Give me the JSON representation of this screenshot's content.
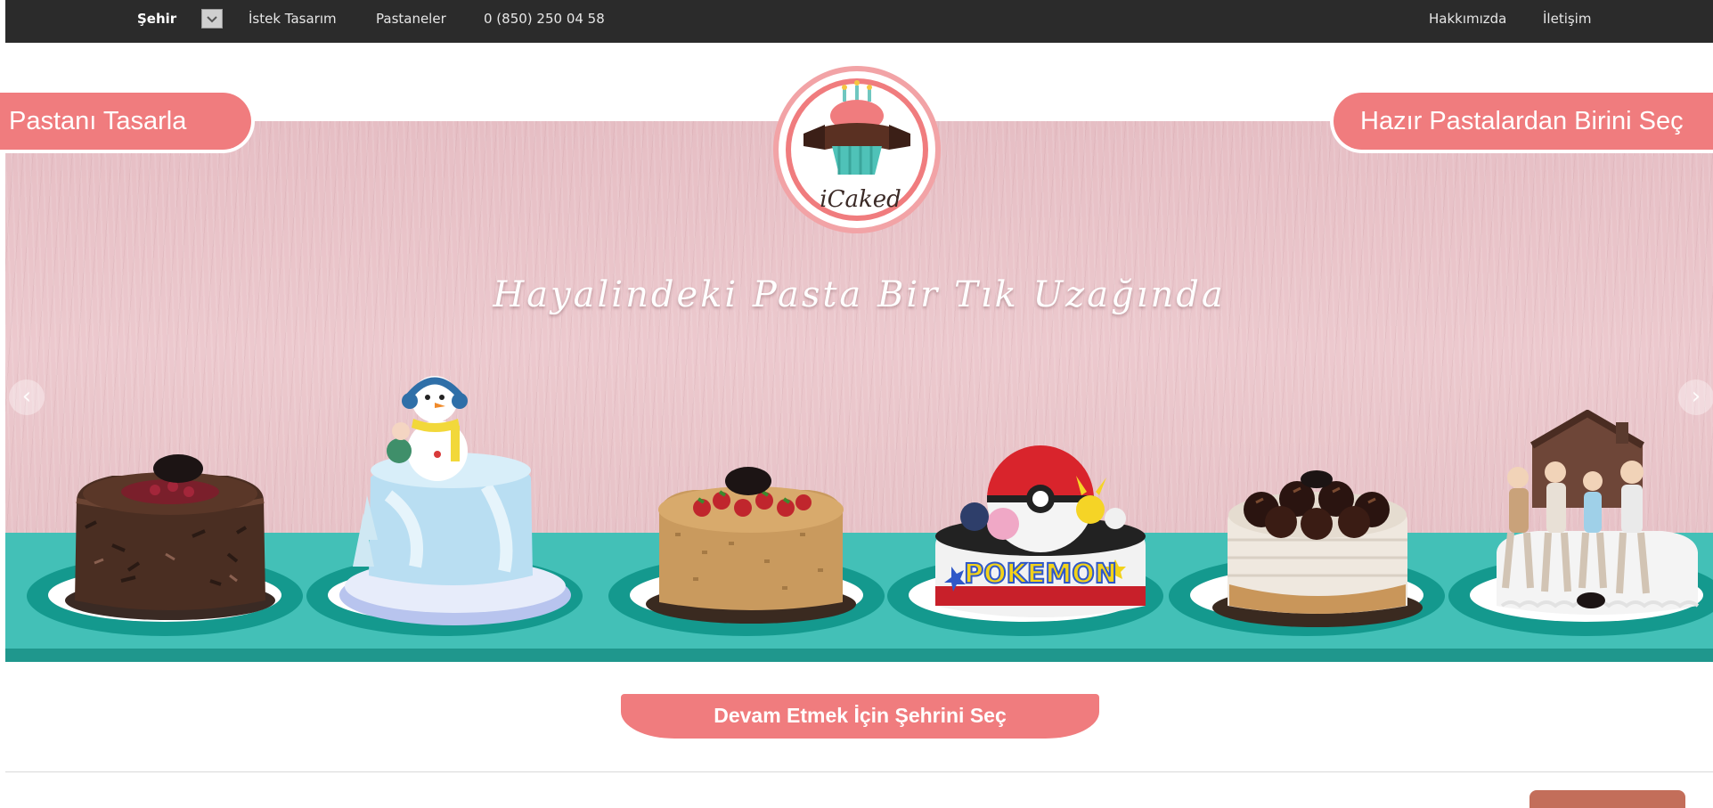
{
  "nav": {
    "city_label": "Şehir",
    "city_select_icon": "chevron-down-icon",
    "design_label": "İstek Tasarım",
    "shops_label": "Pastaneler",
    "phone": "0 (850) 250 04 58",
    "about_label": "Hakkımızda",
    "contact_label": "İletişim"
  },
  "hero": {
    "design_ribbon": "Pastanı Tasarla",
    "ready_ribbon": "Hazır Pastalardan Birini Seç",
    "slogan": "Hayalindeki Pasta Bir Tık Uzağında",
    "logo_text": "iCaked",
    "prev_icon": "chevron-left-icon",
    "next_icon": "chevron-right-icon",
    "cakes": [
      {
        "name": "black-forest-cake"
      },
      {
        "name": "snowman-cake"
      },
      {
        "name": "strawberry-crumb-cake"
      },
      {
        "name": "pokemon-cake",
        "text": "POKEMON"
      },
      {
        "name": "profiterole-cake"
      },
      {
        "name": "family-house-cake"
      }
    ]
  },
  "cta": {
    "label": "Devam Etmek İçin Şehrini Seç"
  },
  "colors": {
    "accent": "#f07c7e",
    "teal": "#43c0b7",
    "nav_bg": "#2b2b2b",
    "hero_bg": "#e8c2c7"
  }
}
